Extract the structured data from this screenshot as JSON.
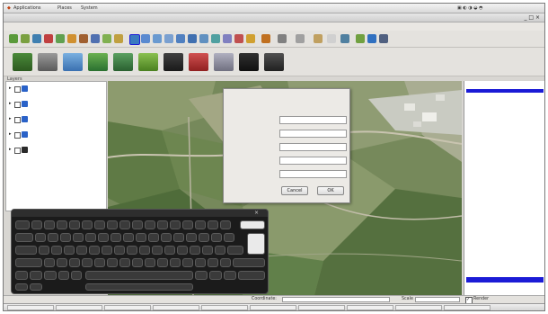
{
  "sysbar": {
    "menu": [
      "Applications",
      "Places",
      "System"
    ],
    "clock": ""
  },
  "window": {
    "title": ""
  },
  "menubar": [
    {
      "label": ""
    },
    {
      "label": ""
    },
    {
      "label": ""
    },
    {
      "label": ""
    },
    {
      "label": ""
    },
    {
      "label": ""
    },
    {
      "label": ""
    },
    {
      "label": ""
    },
    {
      "label": ""
    },
    {
      "label": ""
    }
  ],
  "layers_panel": {
    "title": "Layers",
    "items": [
      {
        "name": "",
        "color": "#2a62c8"
      },
      {
        "name": "",
        "color": "#2a62c8"
      },
      {
        "name": "",
        "color": "#2a62c8"
      },
      {
        "name": "",
        "color": "#2a62c8"
      },
      {
        "name": "",
        "color": "#2a2a2a"
      }
    ]
  },
  "right_panel": {
    "title": ""
  },
  "dialog": {
    "message": "",
    "fields": [
      {
        "label": "",
        "value": ""
      },
      {
        "label": "",
        "value": ""
      },
      {
        "label": "",
        "value": ""
      },
      {
        "label": "",
        "value": ""
      },
      {
        "label": "",
        "value": ""
      }
    ],
    "cancel_label": "Cancel",
    "ok_label": "OK"
  },
  "keyboard": {
    "title": ""
  },
  "statusbar": {
    "coordinate_label": "Coordinate:",
    "coordinate_value": "",
    "scale_label": "Scale",
    "scale_value": "",
    "render_label": "Render",
    "crs_value": ""
  },
  "taskbar": {
    "items": [
      {
        "label": ""
      },
      {
        "label": ""
      },
      {
        "label": ""
      },
      {
        "label": ""
      },
      {
        "label": ""
      },
      {
        "label": ""
      },
      {
        "label": ""
      },
      {
        "label": ""
      },
      {
        "label": ""
      },
      {
        "label": ""
      }
    ]
  },
  "colors": {
    "accent": "#1b1bd6",
    "keyboard_bg": "#1b1b1b",
    "map_green": "#6f8454"
  }
}
